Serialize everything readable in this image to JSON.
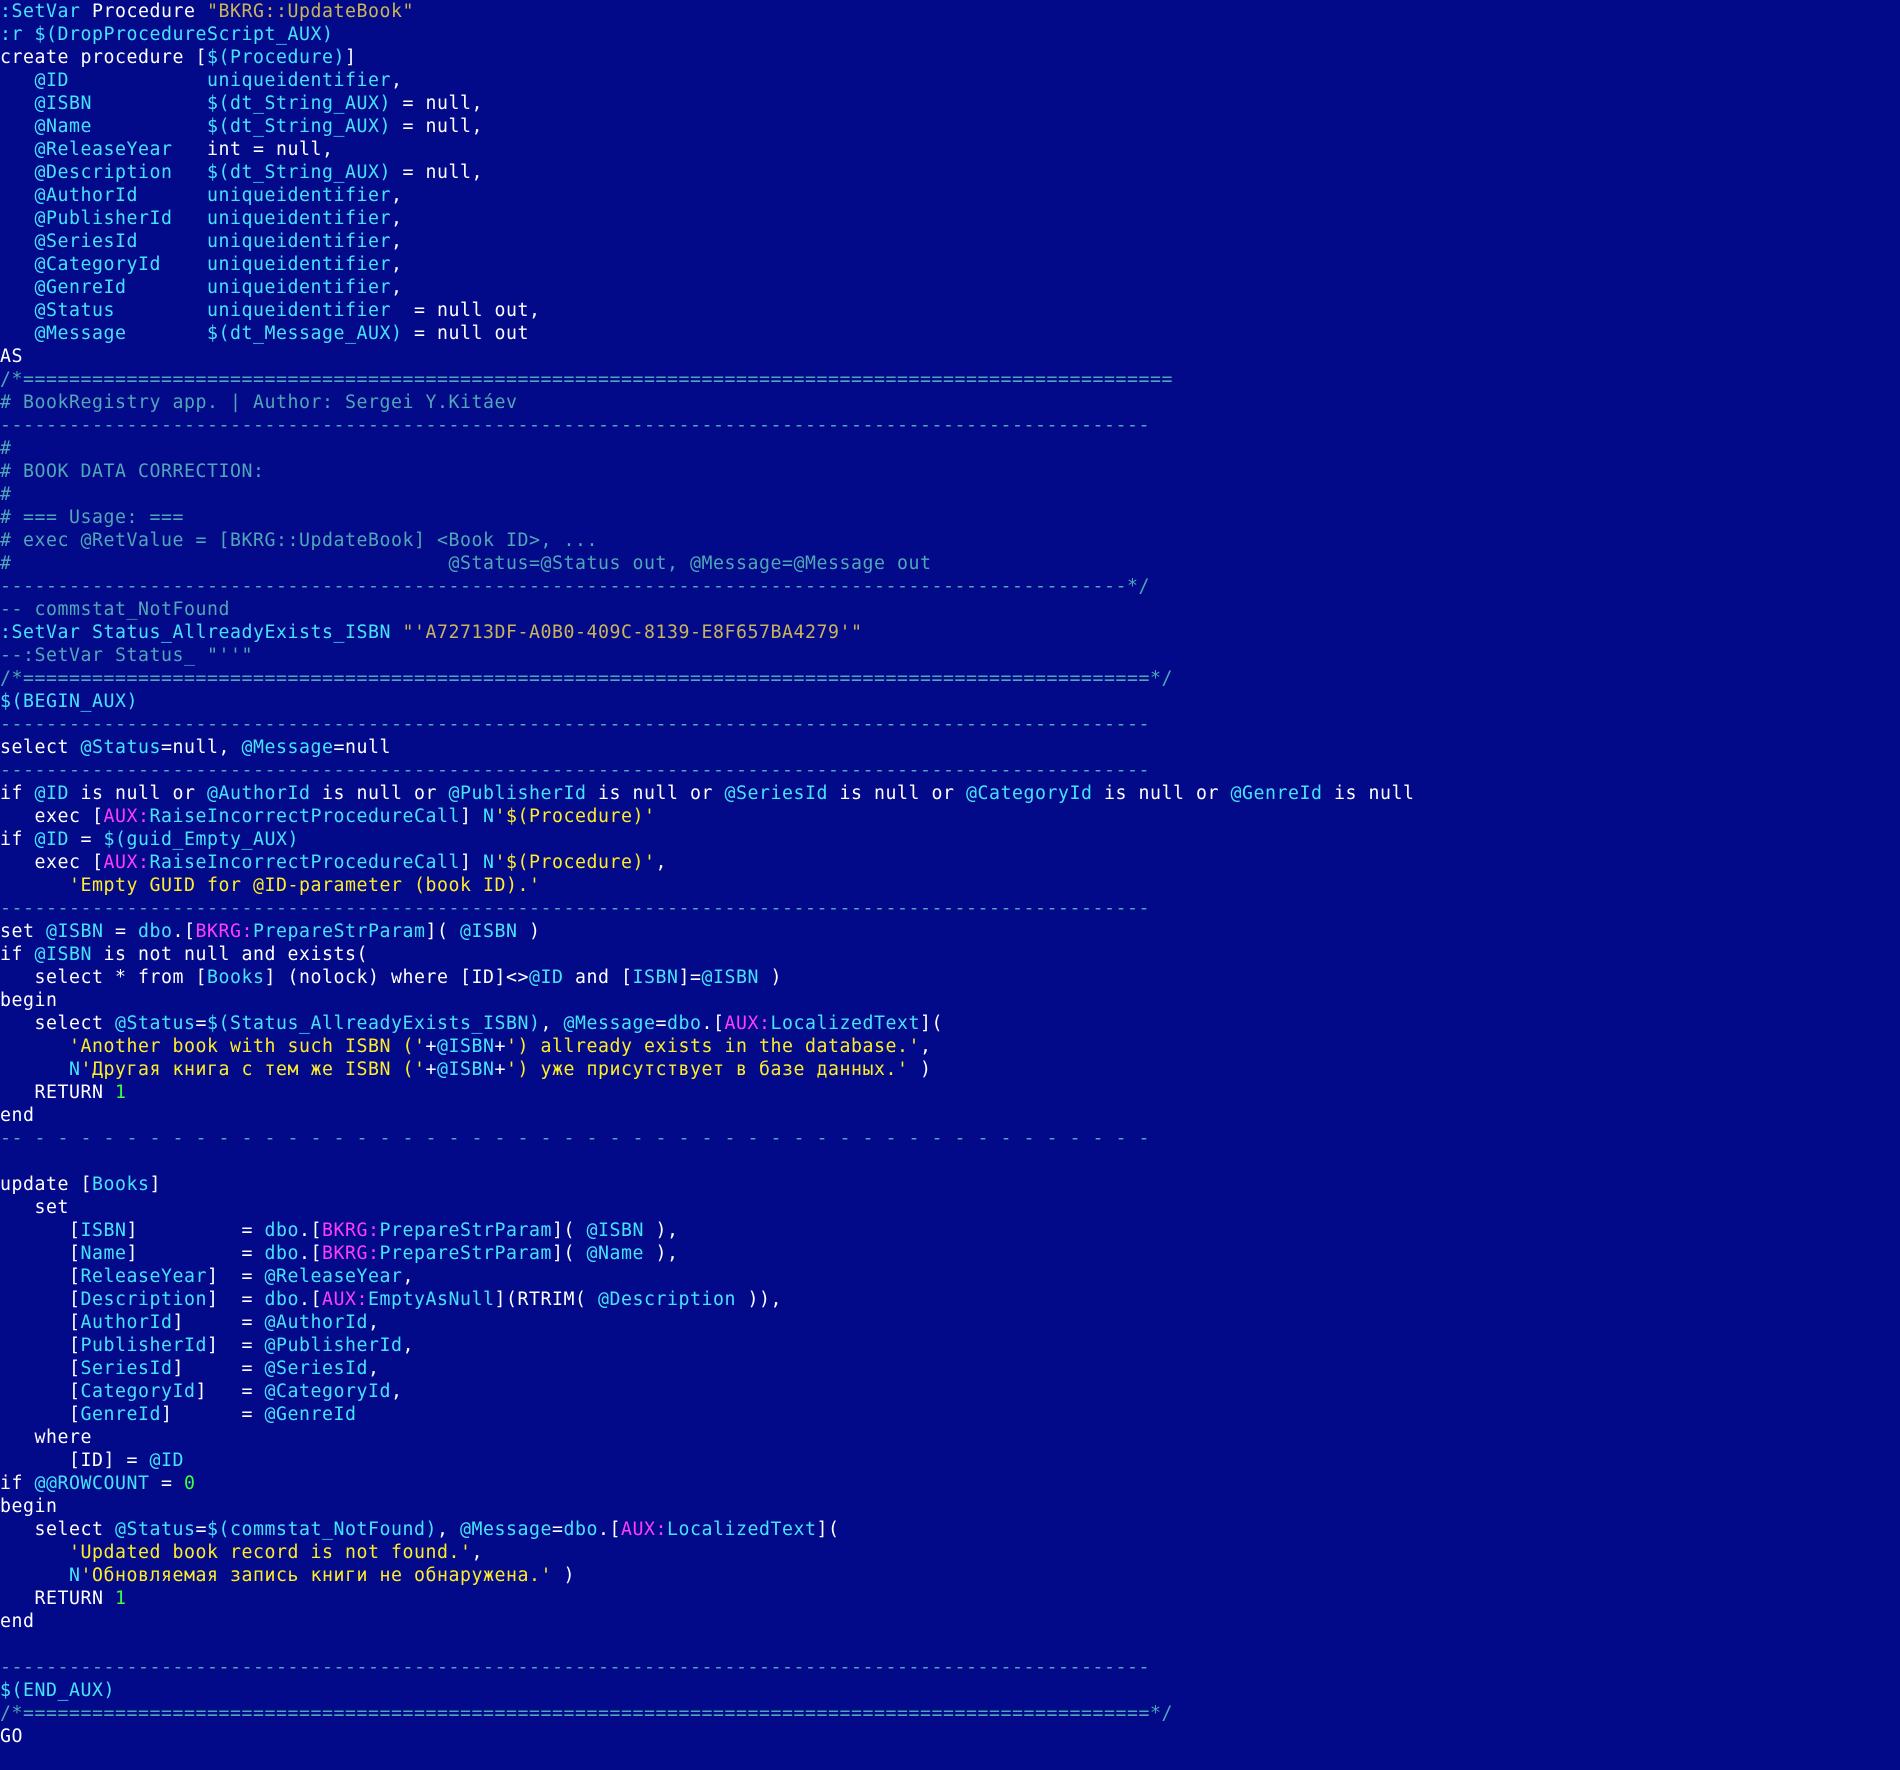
{
  "colors": {
    "background": "#020a8a",
    "plain": "#ffffff",
    "var": "#46e3ff",
    "str": "#ffec2a",
    "strdim": "#c9b45a",
    "comment": "#4fa7b7",
    "num": "#3dff3d",
    "mag": "#ff3cff"
  },
  "lines": [
    [
      [
        "var",
        ":SetVar"
      ],
      [
        "plain",
        " Procedure "
      ],
      [
        "strdim",
        "\"BKRG::UpdateBook\""
      ]
    ],
    [
      [
        "var",
        ":r"
      ],
      [
        "plain",
        " "
      ],
      [
        "var",
        "$(DropProcedureScript_AUX)"
      ]
    ],
    [
      [
        "plain",
        "create procedure ["
      ],
      [
        "var",
        "$(Procedure)"
      ],
      [
        "plain",
        "]"
      ]
    ],
    [
      [
        "plain",
        "   "
      ],
      [
        "var",
        "@ID"
      ],
      [
        "plain",
        "            "
      ],
      [
        "var",
        "uniqueidentifier"
      ],
      [
        "plain",
        ","
      ]
    ],
    [
      [
        "plain",
        "   "
      ],
      [
        "var",
        "@ISBN"
      ],
      [
        "plain",
        "          "
      ],
      [
        "var",
        "$(dt_String_AUX)"
      ],
      [
        "plain",
        " = null,"
      ]
    ],
    [
      [
        "plain",
        "   "
      ],
      [
        "var",
        "@Name"
      ],
      [
        "plain",
        "          "
      ],
      [
        "var",
        "$(dt_String_AUX)"
      ],
      [
        "plain",
        " = null,"
      ]
    ],
    [
      [
        "plain",
        "   "
      ],
      [
        "var",
        "@ReleaseYear"
      ],
      [
        "plain",
        "   int = null,"
      ]
    ],
    [
      [
        "plain",
        "   "
      ],
      [
        "var",
        "@Description"
      ],
      [
        "plain",
        "   "
      ],
      [
        "var",
        "$(dt_String_AUX)"
      ],
      [
        "plain",
        " = null,"
      ]
    ],
    [
      [
        "plain",
        "   "
      ],
      [
        "var",
        "@AuthorId"
      ],
      [
        "plain",
        "      "
      ],
      [
        "var",
        "uniqueidentifier"
      ],
      [
        "plain",
        ","
      ]
    ],
    [
      [
        "plain",
        "   "
      ],
      [
        "var",
        "@PublisherId"
      ],
      [
        "plain",
        "   "
      ],
      [
        "var",
        "uniqueidentifier"
      ],
      [
        "plain",
        ","
      ]
    ],
    [
      [
        "plain",
        "   "
      ],
      [
        "var",
        "@SeriesId"
      ],
      [
        "plain",
        "      "
      ],
      [
        "var",
        "uniqueidentifier"
      ],
      [
        "plain",
        ","
      ]
    ],
    [
      [
        "plain",
        "   "
      ],
      [
        "var",
        "@CategoryId"
      ],
      [
        "plain",
        "    "
      ],
      [
        "var",
        "uniqueidentifier"
      ],
      [
        "plain",
        ","
      ]
    ],
    [
      [
        "plain",
        "   "
      ],
      [
        "var",
        "@GenreId"
      ],
      [
        "plain",
        "       "
      ],
      [
        "var",
        "uniqueidentifier"
      ],
      [
        "plain",
        ","
      ]
    ],
    [
      [
        "plain",
        "   "
      ],
      [
        "var",
        "@Status"
      ],
      [
        "plain",
        "        "
      ],
      [
        "var",
        "uniqueidentifier"
      ],
      [
        "plain",
        "  = null out,"
      ]
    ],
    [
      [
        "plain",
        "   "
      ],
      [
        "var",
        "@Message"
      ],
      [
        "plain",
        "       "
      ],
      [
        "var",
        "$(dt_Message_AUX)"
      ],
      [
        "plain",
        " = null out"
      ]
    ],
    [
      [
        "plain",
        "AS"
      ]
    ],
    [
      [
        "comment",
        "/*===================================================================================================="
      ]
    ],
    [
      [
        "comment",
        "# BookRegistry app. | Author: Sergei Y.Kitáev"
      ]
    ],
    [
      [
        "comment",
        "----------------------------------------------------------------------------------------------------"
      ]
    ],
    [
      [
        "comment",
        "#"
      ]
    ],
    [
      [
        "comment",
        "# BOOK DATA CORRECTION:"
      ]
    ],
    [
      [
        "comment",
        "#"
      ]
    ],
    [
      [
        "comment",
        "# === Usage: ==="
      ]
    ],
    [
      [
        "comment",
        "# exec @RetValue = [BKRG::UpdateBook] <Book ID>, ..."
      ]
    ],
    [
      [
        "comment",
        "#                                      @Status=@Status out, @Message=@Message out"
      ]
    ],
    [
      [
        "comment",
        "--------------------------------------------------------------------------------------------------*/"
      ]
    ],
    [
      [
        "comment",
        "-- commstat_NotFound"
      ]
    ],
    [
      [
        "var",
        ":SetVar"
      ],
      [
        "plain",
        " "
      ],
      [
        "var",
        "Status_AllreadyExists_ISBN"
      ],
      [
        "plain",
        " "
      ],
      [
        "strdim",
        "\"'A72713DF-A0B0-409C-8139-E8F657BA4279'\""
      ]
    ],
    [
      [
        "comment",
        "--:SetVar Status_ \"''\""
      ]
    ],
    [
      [
        "comment",
        "/*==================================================================================================*/"
      ]
    ],
    [
      [
        "var",
        "$(BEGIN_AUX)"
      ]
    ],
    [
      [
        "comment",
        "----------------------------------------------------------------------------------------------------"
      ]
    ],
    [
      [
        "plain",
        "select "
      ],
      [
        "var",
        "@Status"
      ],
      [
        "plain",
        "=null, "
      ],
      [
        "var",
        "@Message"
      ],
      [
        "plain",
        "=null"
      ]
    ],
    [
      [
        "comment",
        "----------------------------------------------------------------------------------------------------"
      ]
    ],
    [
      [
        "plain",
        "if "
      ],
      [
        "var",
        "@ID"
      ],
      [
        "plain",
        " is null or "
      ],
      [
        "var",
        "@AuthorId"
      ],
      [
        "plain",
        " is null or "
      ],
      [
        "var",
        "@PublisherId"
      ],
      [
        "plain",
        " is null or "
      ],
      [
        "var",
        "@SeriesId"
      ],
      [
        "plain",
        " is null or "
      ],
      [
        "var",
        "@CategoryId"
      ],
      [
        "plain",
        " is null or "
      ],
      [
        "var",
        "@GenreId"
      ],
      [
        "plain",
        " is null"
      ]
    ],
    [
      [
        "plain",
        "   exec ["
      ],
      [
        "mag",
        "AUX:"
      ],
      [
        "var",
        "RaiseIncorrectProcedureCall"
      ],
      [
        "plain",
        "] "
      ],
      [
        "var",
        "N"
      ],
      [
        "str",
        "'$(Procedure)'"
      ]
    ],
    [
      [
        "plain",
        "if "
      ],
      [
        "var",
        "@ID"
      ],
      [
        "plain",
        " = "
      ],
      [
        "var",
        "$(guid_Empty_AUX)"
      ]
    ],
    [
      [
        "plain",
        "   exec ["
      ],
      [
        "mag",
        "AUX:"
      ],
      [
        "var",
        "RaiseIncorrectProcedureCall"
      ],
      [
        "plain",
        "] "
      ],
      [
        "var",
        "N"
      ],
      [
        "str",
        "'$(Procedure)'"
      ],
      [
        "plain",
        ","
      ]
    ],
    [
      [
        "plain",
        "      "
      ],
      [
        "str",
        "'Empty GUID for @ID-parameter (book ID).'"
      ]
    ],
    [
      [
        "comment",
        "----------------------------------------------------------------------------------------------------"
      ]
    ],
    [
      [
        "plain",
        "set "
      ],
      [
        "var",
        "@ISBN"
      ],
      [
        "plain",
        " = "
      ],
      [
        "var",
        "dbo"
      ],
      [
        "plain",
        ".["
      ],
      [
        "mag",
        "BKRG:"
      ],
      [
        "var",
        "PrepareStrParam"
      ],
      [
        "plain",
        "]( "
      ],
      [
        "var",
        "@ISBN"
      ],
      [
        "plain",
        " )"
      ]
    ],
    [
      [
        "plain",
        "if "
      ],
      [
        "var",
        "@ISBN"
      ],
      [
        "plain",
        " is not null and exists("
      ]
    ],
    [
      [
        "plain",
        "   select * from ["
      ],
      [
        "var",
        "Books"
      ],
      [
        "plain",
        "] (nolock) where [ID]<>"
      ],
      [
        "var",
        "@ID"
      ],
      [
        "plain",
        " and ["
      ],
      [
        "var",
        "ISBN"
      ],
      [
        "plain",
        "]="
      ],
      [
        "var",
        "@ISBN"
      ],
      [
        "plain",
        " )"
      ]
    ],
    [
      [
        "plain",
        "begin"
      ]
    ],
    [
      [
        "plain",
        "   select "
      ],
      [
        "var",
        "@Status"
      ],
      [
        "plain",
        "="
      ],
      [
        "var",
        "$(Status_AllreadyExists_ISBN)"
      ],
      [
        "plain",
        ", "
      ],
      [
        "var",
        "@Message"
      ],
      [
        "plain",
        "="
      ],
      [
        "var",
        "dbo"
      ],
      [
        "plain",
        ".["
      ],
      [
        "mag",
        "AUX:"
      ],
      [
        "var",
        "LocalizedText"
      ],
      [
        "plain",
        "]("
      ]
    ],
    [
      [
        "plain",
        "      "
      ],
      [
        "str",
        "'Another book with such ISBN ('"
      ],
      [
        "plain",
        "+"
      ],
      [
        "var",
        "@ISBN"
      ],
      [
        "plain",
        "+"
      ],
      [
        "str",
        "') allready exists in the database.'"
      ],
      [
        "plain",
        ","
      ]
    ],
    [
      [
        "plain",
        "      "
      ],
      [
        "var",
        "N"
      ],
      [
        "str",
        "'Другая книга с тем же ISBN ('"
      ],
      [
        "plain",
        "+"
      ],
      [
        "var",
        "@ISBN"
      ],
      [
        "plain",
        "+"
      ],
      [
        "str",
        "') уже присутствует в базе данных.'"
      ],
      [
        "plain",
        " )"
      ]
    ],
    [
      [
        "plain",
        "   RETURN "
      ],
      [
        "num",
        "1"
      ]
    ],
    [
      [
        "plain",
        "end"
      ]
    ],
    [
      [
        "comment",
        "-- - - - - - - - - - - - - - - - - - - - - - - - - - - - - - - - - - - - - - - - - - - - - - - - - -"
      ]
    ],
    [
      [
        "plain",
        ""
      ]
    ],
    [
      [
        "plain",
        "update ["
      ],
      [
        "var",
        "Books"
      ],
      [
        "plain",
        "]"
      ]
    ],
    [
      [
        "plain",
        "   set"
      ]
    ],
    [
      [
        "plain",
        "      ["
      ],
      [
        "var",
        "ISBN"
      ],
      [
        "plain",
        "]         = "
      ],
      [
        "var",
        "dbo"
      ],
      [
        "plain",
        ".["
      ],
      [
        "mag",
        "BKRG:"
      ],
      [
        "var",
        "PrepareStrParam"
      ],
      [
        "plain",
        "]( "
      ],
      [
        "var",
        "@ISBN"
      ],
      [
        "plain",
        " ),"
      ]
    ],
    [
      [
        "plain",
        "      ["
      ],
      [
        "var",
        "Name"
      ],
      [
        "plain",
        "]         = "
      ],
      [
        "var",
        "dbo"
      ],
      [
        "plain",
        ".["
      ],
      [
        "mag",
        "BKRG:"
      ],
      [
        "var",
        "PrepareStrParam"
      ],
      [
        "plain",
        "]( "
      ],
      [
        "var",
        "@Name"
      ],
      [
        "plain",
        " ),"
      ]
    ],
    [
      [
        "plain",
        "      ["
      ],
      [
        "var",
        "ReleaseYear"
      ],
      [
        "plain",
        "]  = "
      ],
      [
        "var",
        "@ReleaseYear"
      ],
      [
        "plain",
        ","
      ]
    ],
    [
      [
        "plain",
        "      ["
      ],
      [
        "var",
        "Description"
      ],
      [
        "plain",
        "]  = "
      ],
      [
        "var",
        "dbo"
      ],
      [
        "plain",
        ".["
      ],
      [
        "mag",
        "AUX:"
      ],
      [
        "var",
        "EmptyAsNull"
      ],
      [
        "plain",
        "](RTRIM( "
      ],
      [
        "var",
        "@Description"
      ],
      [
        "plain",
        " )),"
      ]
    ],
    [
      [
        "plain",
        "      ["
      ],
      [
        "var",
        "AuthorId"
      ],
      [
        "plain",
        "]     = "
      ],
      [
        "var",
        "@AuthorId"
      ],
      [
        "plain",
        ","
      ]
    ],
    [
      [
        "plain",
        "      ["
      ],
      [
        "var",
        "PublisherId"
      ],
      [
        "plain",
        "]  = "
      ],
      [
        "var",
        "@PublisherId"
      ],
      [
        "plain",
        ","
      ]
    ],
    [
      [
        "plain",
        "      ["
      ],
      [
        "var",
        "SeriesId"
      ],
      [
        "plain",
        "]     = "
      ],
      [
        "var",
        "@SeriesId"
      ],
      [
        "plain",
        ","
      ]
    ],
    [
      [
        "plain",
        "      ["
      ],
      [
        "var",
        "CategoryId"
      ],
      [
        "plain",
        "]   = "
      ],
      [
        "var",
        "@CategoryId"
      ],
      [
        "plain",
        ","
      ]
    ],
    [
      [
        "plain",
        "      ["
      ],
      [
        "var",
        "GenreId"
      ],
      [
        "plain",
        "]      = "
      ],
      [
        "var",
        "@GenreId"
      ]
    ],
    [
      [
        "plain",
        "   where"
      ]
    ],
    [
      [
        "plain",
        "      [ID] = "
      ],
      [
        "var",
        "@ID"
      ]
    ],
    [
      [
        "plain",
        "if "
      ],
      [
        "var",
        "@@ROWCOUNT"
      ],
      [
        "plain",
        " = "
      ],
      [
        "num",
        "0"
      ]
    ],
    [
      [
        "plain",
        "begin"
      ]
    ],
    [
      [
        "plain",
        "   select "
      ],
      [
        "var",
        "@Status"
      ],
      [
        "plain",
        "="
      ],
      [
        "var",
        "$(commstat_NotFound)"
      ],
      [
        "plain",
        ", "
      ],
      [
        "var",
        "@Message"
      ],
      [
        "plain",
        "="
      ],
      [
        "var",
        "dbo"
      ],
      [
        "plain",
        ".["
      ],
      [
        "mag",
        "AUX:"
      ],
      [
        "var",
        "LocalizedText"
      ],
      [
        "plain",
        "]("
      ]
    ],
    [
      [
        "plain",
        "      "
      ],
      [
        "str",
        "'Updated book record is not found.'"
      ],
      [
        "plain",
        ","
      ]
    ],
    [
      [
        "plain",
        "      "
      ],
      [
        "var",
        "N"
      ],
      [
        "str",
        "'Обновляемая запись книги не обнаружена.'"
      ],
      [
        "plain",
        " )"
      ]
    ],
    [
      [
        "plain",
        "   RETURN "
      ],
      [
        "num",
        "1"
      ]
    ],
    [
      [
        "plain",
        "end"
      ]
    ],
    [
      [
        "plain",
        ""
      ]
    ],
    [
      [
        "comment",
        "----------------------------------------------------------------------------------------------------"
      ]
    ],
    [
      [
        "var",
        "$(END_AUX)"
      ]
    ],
    [
      [
        "comment",
        "/*==================================================================================================*/"
      ]
    ],
    [
      [
        "plain",
        "GO"
      ]
    ]
  ]
}
